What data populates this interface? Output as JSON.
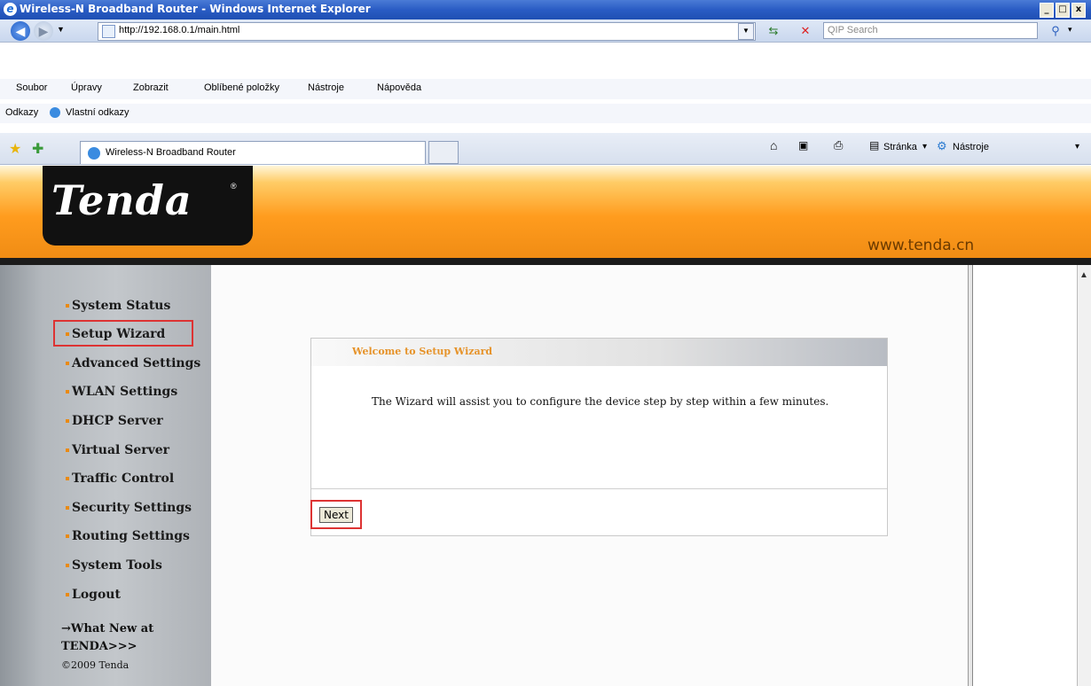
{
  "window": {
    "title": "Wireless-N Broadband Router - Windows Internet Explorer",
    "min": "_",
    "max": "□",
    "close": "x"
  },
  "addressbar": {
    "url": "http://192.168.0.1/main.html",
    "search_placeholder": "QIP Search"
  },
  "menu": [
    "Soubor",
    "Úpravy",
    "Zobrazit",
    "Oblíbené položky",
    "Nástroje",
    "Nápověda"
  ],
  "links": {
    "label": "Odkazy",
    "item": "Vlastní odkazy"
  },
  "tab": {
    "title": "Wireless-N Broadband Router"
  },
  "toolbar": {
    "page": "Stránka",
    "tools": "Nástroje"
  },
  "header": {
    "logo": "Tenda",
    "reg": "®",
    "website": "www.tenda.cn"
  },
  "sidebar": {
    "items": [
      "System Status",
      "Setup Wizard",
      "Advanced Settings",
      "WLAN Settings",
      "DHCP Server",
      "Virtual Server",
      "Traffic Control",
      "Security Settings",
      "Routing Settings",
      "System Tools",
      "Logout"
    ],
    "selected": "Setup Wizard",
    "whatnew": "→What New at TENDA>>>",
    "copyright": "©2009 Tenda"
  },
  "wizard": {
    "title": "Welcome to Setup Wizard",
    "description": "The Wizard will assist you to configure the device step by step within a few minutes.",
    "next": "Next"
  },
  "colors": {
    "accent_orange": "#f08c14",
    "highlight_red": "#dd3333",
    "title_blue": "#2a5cc4"
  }
}
